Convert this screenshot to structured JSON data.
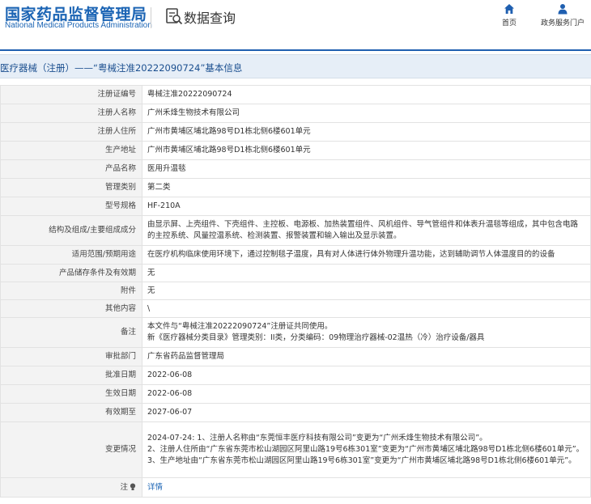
{
  "header": {
    "logo_cn": "国家药品监督管理局",
    "logo_en": "National Medical Products Administration",
    "query_title": "数据查询",
    "nav": {
      "home": "首页",
      "portal": "政务服务门户"
    }
  },
  "section_title": "医疗器械（注册）——“粤械注准20222090724”基本信息",
  "rows": [
    {
      "label": "注册证编号",
      "value": "粤械注准20222090724"
    },
    {
      "label": "注册人名称",
      "value": "广州禾烽生物技术有限公司"
    },
    {
      "label": "注册人住所",
      "value": "广州市黄埔区埔北路98号D1栋北侧6楼601单元"
    },
    {
      "label": "生产地址",
      "value": "广州市黄埔区埔北路98号D1栋北侧6楼601单元"
    },
    {
      "label": "产品名称",
      "value": "医用升温毯"
    },
    {
      "label": "管理类别",
      "value": "第二类"
    },
    {
      "label": "型号规格",
      "value": "HF-210A"
    },
    {
      "label": "结构及组成/主要组成成分",
      "value": "由显示屏、上壳组件、下壳组件、主控板、电源板、加热装置组件、风机组件、导气管组件和体表升温毯等组成，其中包含电路的主控系统、风量控温系统、检测装置、报警装置和输入输出及显示装置。"
    },
    {
      "label": "适用范围/预期用途",
      "value": "在医疗机构临床使用环境下，通过控制毯子温度，具有对人体进行体外物理升温功能，达到辅助调节人体温度目的的设备"
    },
    {
      "label": "产品储存条件及有效期",
      "value": "无"
    },
    {
      "label": "附件",
      "value": "无"
    },
    {
      "label": "其他内容",
      "value": "\\"
    },
    {
      "label": "备注",
      "lines": [
        "本文件与“粤械注准20222090724”注册证共同使用。",
        "新《医疗器械分类目录》管理类别：II类，分类编码：09物理治疗器械-02温热（冷）治疗设备/器具"
      ]
    },
    {
      "label": "审批部门",
      "value": "广东省药品监督管理局"
    },
    {
      "label": "批准日期",
      "value": "2022-06-08"
    },
    {
      "label": "生效日期",
      "value": "2022-06-08"
    },
    {
      "label": "有效期至",
      "value": "2027-06-07"
    },
    {
      "label": "变更情况",
      "lines": [
        "2024-07-24: 1、注册人名称由“东莞恒丰医疗科技有限公司”变更为“广州禾烽生物技术有限公司”。",
        "2、注册人住所由“广东省东莞市松山湖园区阿里山路19号6栋301室”变更为“广州市黄埔区埔北路98号D1栋北侧6楼601单元”。",
        "3、生产地址由“广东省东莞市松山湖园区阿里山路19号6栋301室”变更为“广州市黄埔区埔北路98号D1栋北侧6楼601单元”。"
      ]
    },
    {
      "label": "注",
      "value": "详情"
    }
  ],
  "colors": {
    "brand_blue": "#1b64b4",
    "divider_blue": "#1f5fb0",
    "title_bar_bg": "#e6eef7",
    "label_bg": "#f3f3f3"
  },
  "icons": {
    "query": "search-document-icon",
    "home": "home-icon",
    "portal": "person-icon",
    "note": "lightbulb-icon"
  }
}
